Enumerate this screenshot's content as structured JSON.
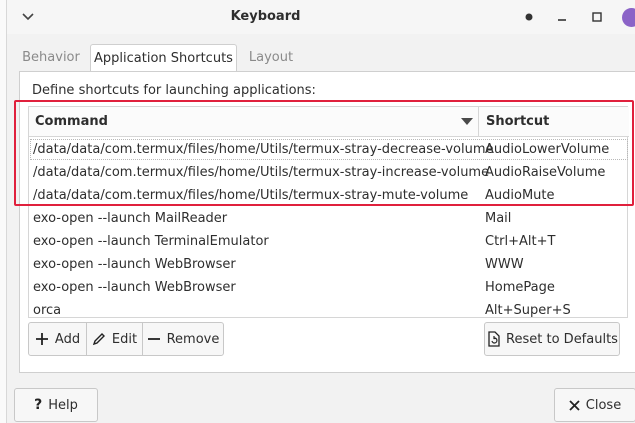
{
  "window": {
    "title": "Keyboard"
  },
  "tabs": [
    {
      "label": "Behavior",
      "active": false
    },
    {
      "label": "Application Shortcuts",
      "active": true
    },
    {
      "label": "Layout",
      "active": false
    }
  ],
  "page": {
    "description": "Define shortcuts for launching applications:"
  },
  "list": {
    "columns": {
      "command": "Command",
      "shortcut": "Shortcut"
    },
    "rows": [
      {
        "command": "/data/data/com.termux/files/home/Utils/termux-stray-decrease-volume",
        "shortcut": "AudioLowerVolume"
      },
      {
        "command": "/data/data/com.termux/files/home/Utils/termux-stray-increase-volume",
        "shortcut": "AudioRaiseVolume"
      },
      {
        "command": "/data/data/com.termux/files/home/Utils/termux-stray-mute-volume",
        "shortcut": "AudioMute"
      },
      {
        "command": "exo-open --launch MailReader",
        "shortcut": "Mail"
      },
      {
        "command": "exo-open --launch TerminalEmulator",
        "shortcut": "Ctrl+Alt+T"
      },
      {
        "command": "exo-open --launch WebBrowser",
        "shortcut": "WWW"
      },
      {
        "command": "exo-open --launch WebBrowser",
        "shortcut": "HomePage"
      },
      {
        "command": "orca",
        "shortcut": "Alt+Super+S"
      }
    ]
  },
  "toolbar": {
    "add_label": "Add",
    "edit_label": "Edit",
    "remove_label": "Remove",
    "reset_label": "Reset to Defaults"
  },
  "footer": {
    "help_label": "Help",
    "close_label": "Close"
  },
  "colors": {
    "highlight": "#e0203c",
    "close_button": "#8b63c7"
  },
  "icons": {
    "menu": "chevron-down-icon",
    "add": "plus-icon",
    "edit": "pencil-icon",
    "remove": "minus-icon",
    "reset": "document-revert-icon",
    "help": "question-icon",
    "close": "x-icon"
  }
}
